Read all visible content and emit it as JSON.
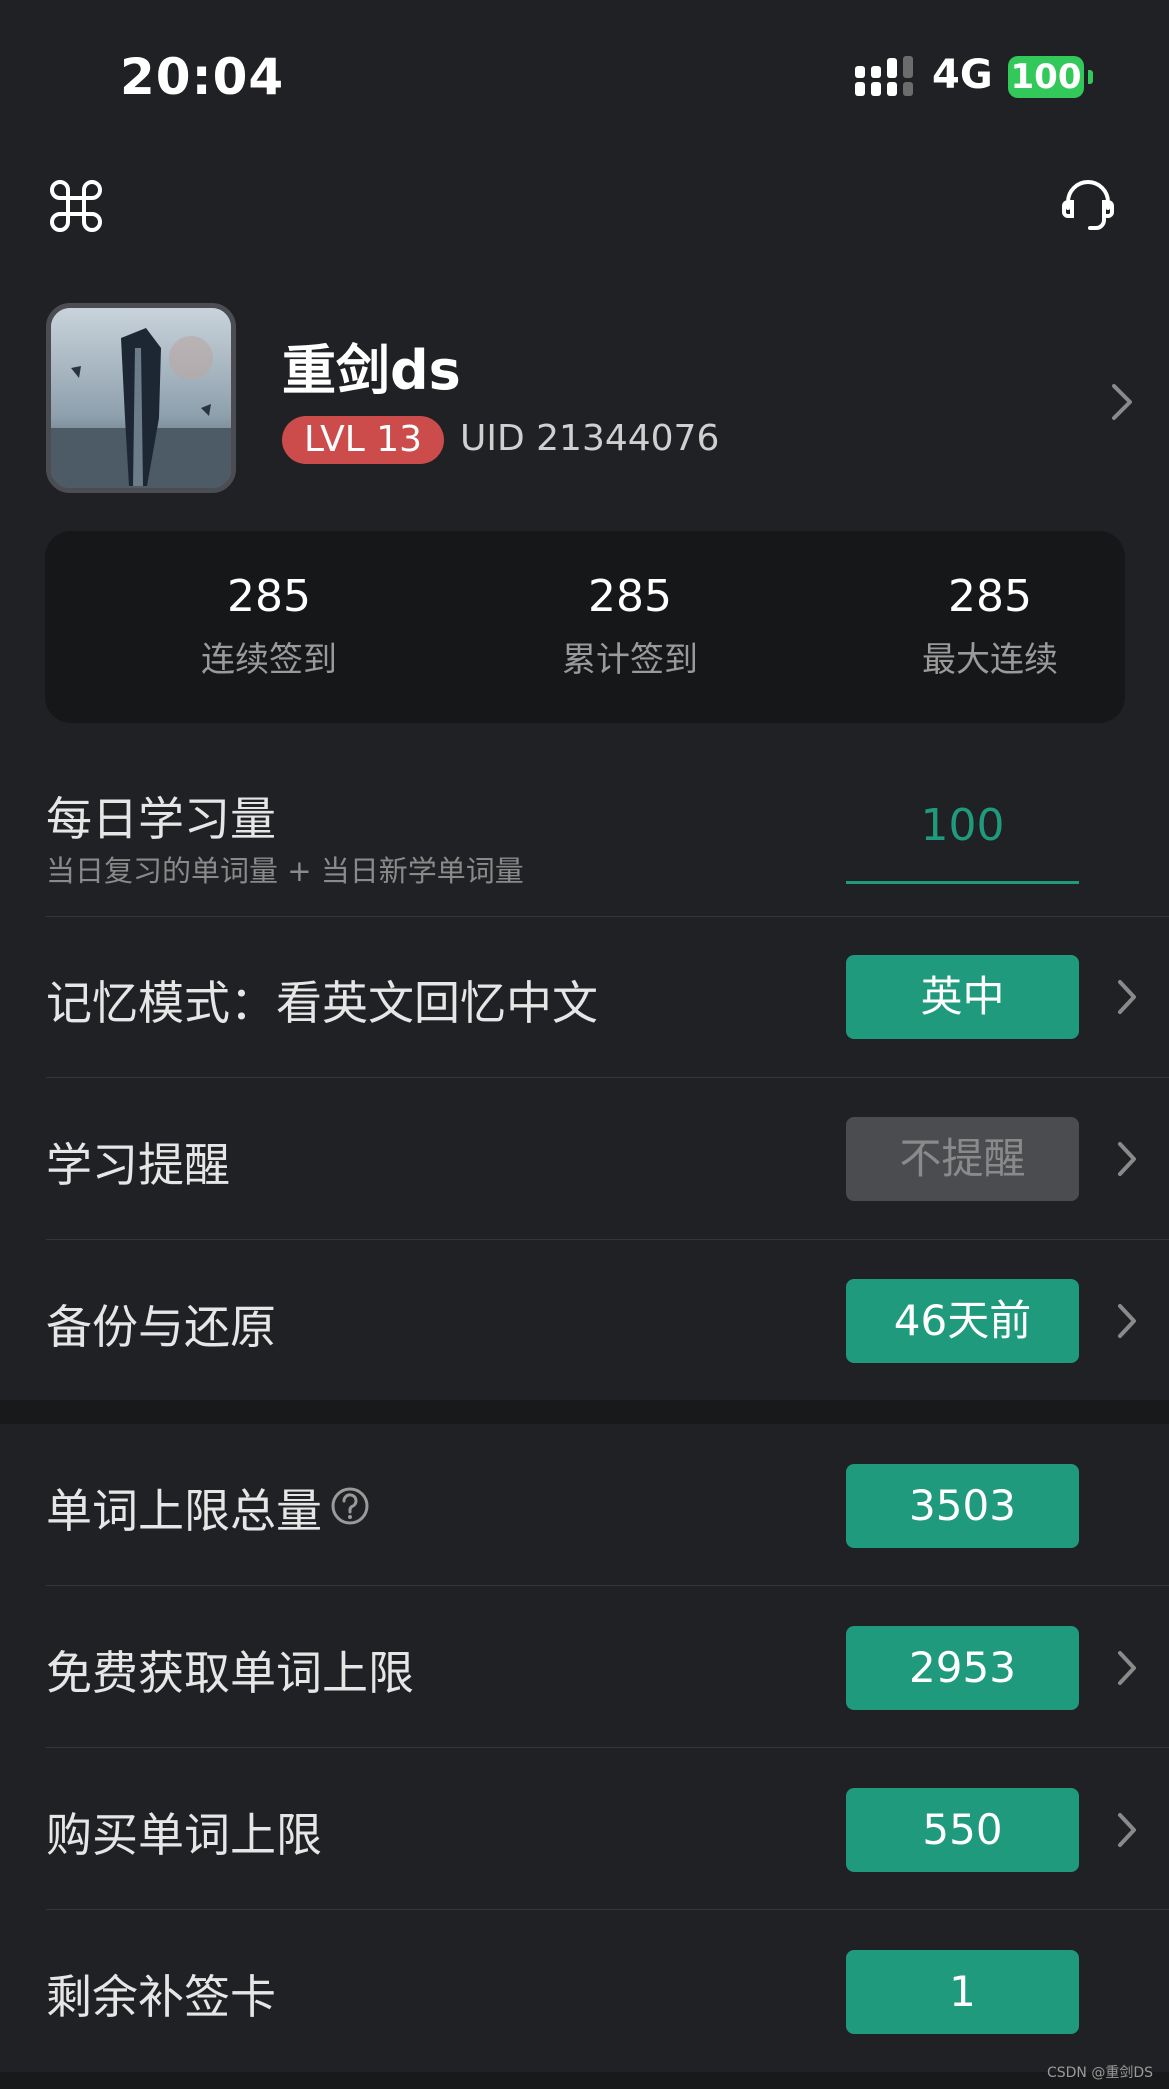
{
  "status_bar": {
    "time": "20:04",
    "network": "4G",
    "battery": "100"
  },
  "header": {
    "left_icon": "command-icon",
    "right_icon": "headset-icon"
  },
  "profile": {
    "name": "重剑ds",
    "level": "LVL 13",
    "uid": "UID 21344076"
  },
  "stats": [
    {
      "value": "285",
      "label": "连续签到"
    },
    {
      "value": "285",
      "label": "累计签到"
    },
    {
      "value": "285",
      "label": "最大连续"
    }
  ],
  "settings": {
    "daily": {
      "label": "每日学习量",
      "sublabel": "当日复习的单词量 + 当日新学单词量",
      "value": "100"
    },
    "memory_mode": {
      "label": "记忆模式：看英文回忆中文",
      "value": "英中"
    },
    "reminder": {
      "label": "学习提醒",
      "value": "不提醒"
    },
    "backup": {
      "label": "备份与还原",
      "value": "46天前"
    }
  },
  "limits": {
    "total": {
      "label": "单词上限总量",
      "value": "3503"
    },
    "free": {
      "label": "免费获取单词上限",
      "value": "2953"
    },
    "purchased": {
      "label": "购买单词上限",
      "value": "550"
    },
    "makeup_cards": {
      "label": "剩余补签卡",
      "value": "1"
    }
  },
  "watermark": "CSDN @重剑DS",
  "colors": {
    "background": "#202124",
    "accent": "#1f9a7c",
    "level_badge": "#cc4b4b",
    "battery": "#32c85a"
  }
}
